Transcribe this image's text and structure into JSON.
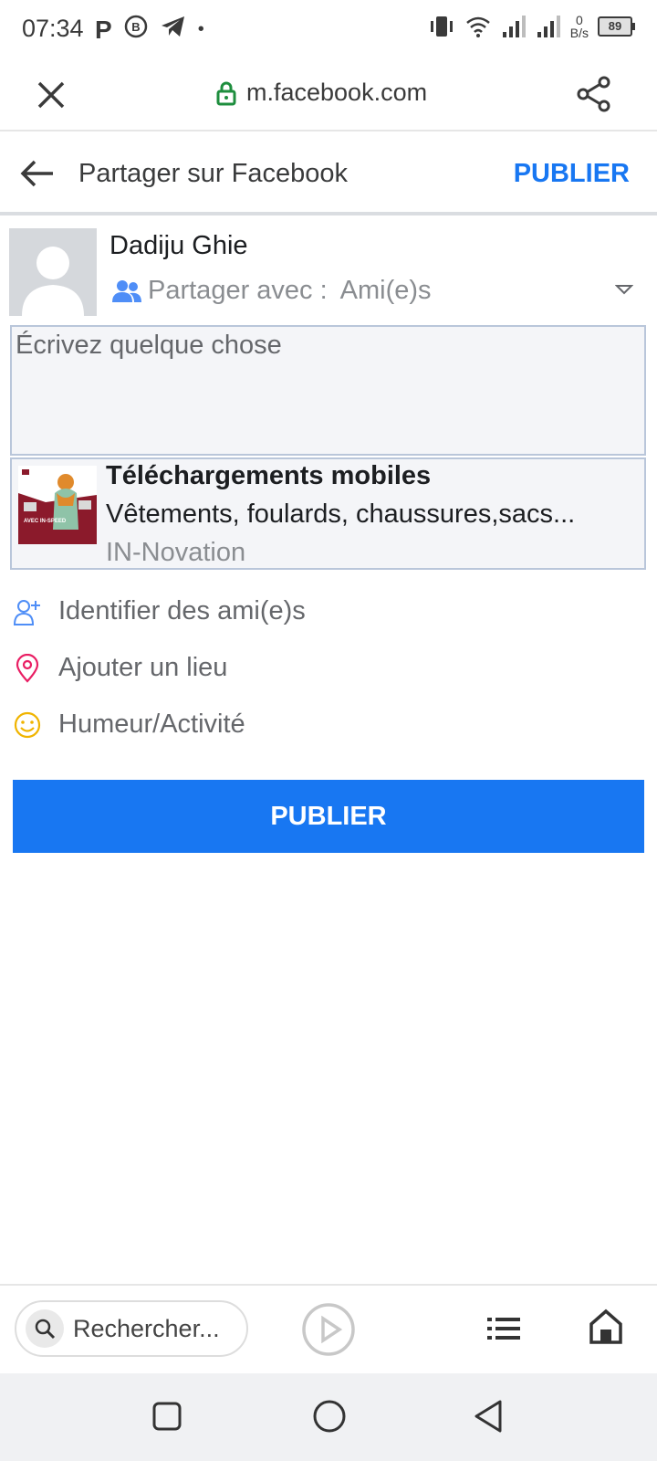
{
  "status_bar": {
    "time": "07:34",
    "net_speed_value": "0",
    "net_speed_unit": "B/s",
    "battery": "89"
  },
  "browser": {
    "url": "m.facebook.com"
  },
  "header": {
    "title": "Partager sur Facebook",
    "publish": "PUBLIER"
  },
  "composer": {
    "user_name": "Dadiju Ghie",
    "audience_prefix": "Partager avec :",
    "audience_value": "Ami(e)s",
    "placeholder": "Écrivez quelque chose"
  },
  "link_card": {
    "title": "Téléchargements mobiles",
    "description": "Vêtements, foulards, chaussures,sacs...",
    "source": "IN-Novation",
    "thumbnail_headline": "AVEC IN-SPEED"
  },
  "actions": {
    "tag_friends": "Identifier des ami(e)s",
    "add_place": "Ajouter un lieu",
    "feeling": "Humeur/Activité"
  },
  "publish_button": "PUBLIER",
  "bottom_toolbar": {
    "search_placeholder": "Rechercher..."
  },
  "colors": {
    "brand_blue": "#1877f2",
    "location_pink": "#e91e63",
    "feeling_yellow": "#f0b400",
    "lock_green": "#1e8e3e"
  }
}
